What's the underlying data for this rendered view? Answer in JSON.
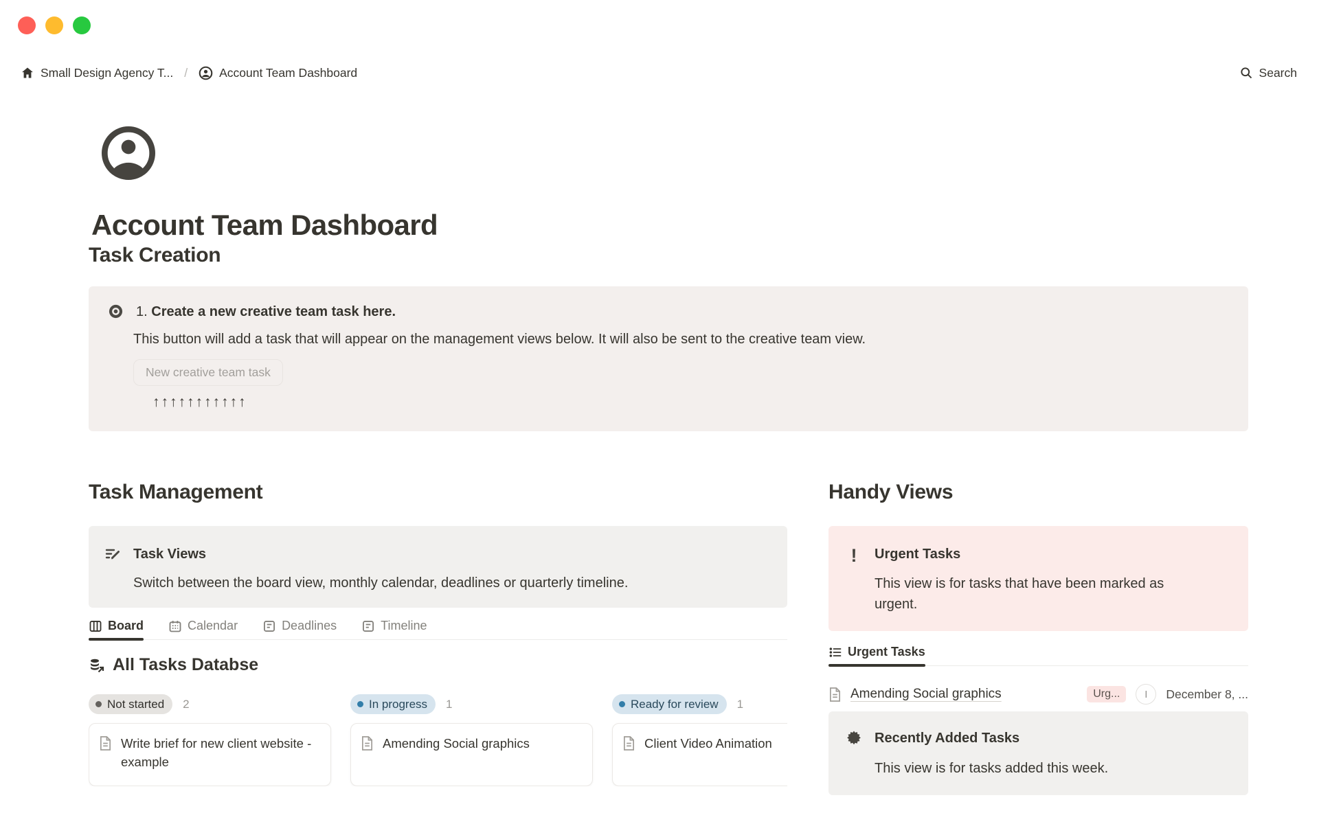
{
  "window": {
    "traffic_lights": [
      "close",
      "minimize",
      "zoom"
    ]
  },
  "breadcrumb": {
    "workspace": "Small Design Agency T...",
    "separator": "/",
    "page": "Account Team Dashboard"
  },
  "topbar": {
    "search_label": "Search"
  },
  "page": {
    "title": "Account Team Dashboard"
  },
  "task_creation": {
    "heading": "Task Creation",
    "callout": {
      "step_prefix": "1.",
      "step_bold": "Create a new creative team task here.",
      "description": "This button will add a task that will appear on the management views below. It will also be sent to the creative team view.",
      "button_label": "New creative team task",
      "arrows": "↑↑↑↑↑↑↑↑↑↑↑"
    }
  },
  "task_management": {
    "heading": "Task Management",
    "callout": {
      "title": "Task Views",
      "description": "Switch between the board view, monthly calendar, deadlines or quarterly timeline."
    },
    "tabs": [
      {
        "label": "Board"
      },
      {
        "label": "Calendar"
      },
      {
        "label": "Deadlines"
      },
      {
        "label": "Timeline"
      }
    ],
    "database_title": "All Tasks Databse",
    "board_columns": [
      {
        "status": "Not started",
        "count": "2",
        "color": "gray",
        "cards": [
          {
            "title": "Write brief for new client website - example"
          }
        ]
      },
      {
        "status": "In progress",
        "count": "1",
        "color": "blue",
        "cards": [
          {
            "title": "Amending Social graphics"
          }
        ]
      },
      {
        "status": "Ready for review",
        "count": "1",
        "color": "blue",
        "cards": [
          {
            "title": "Client Video Animation"
          }
        ]
      }
    ]
  },
  "handy_views": {
    "heading": "Handy Views",
    "urgent_callout": {
      "title": "Urgent Tasks",
      "description": "This view is for tasks that have been marked as urgent."
    },
    "urgent_tab": {
      "label": "Urgent Tasks"
    },
    "urgent_row": {
      "title": "Amending Social graphics",
      "tag": "Urg...",
      "assignee_initial": "I",
      "date": "December 8, ..."
    },
    "recent_callout": {
      "title": "Recently Added Tasks",
      "description": "This view is for tasks added this week."
    }
  },
  "colors": {
    "text_primary": "#37352f",
    "callout_creation_bg": "#f3efed",
    "callout_gray_bg": "#f1f0ee",
    "callout_pink_bg": "#fcebe9",
    "pill_gray_bg": "#e5e3e0",
    "pill_blue_bg": "#d6e4ee",
    "status_blue_dot": "#337ea9",
    "tag_urgent_bg": "#fbe4e2",
    "traffic_red": "#fe5f57",
    "traffic_yellow": "#febb2e",
    "traffic_green": "#27c93f"
  }
}
